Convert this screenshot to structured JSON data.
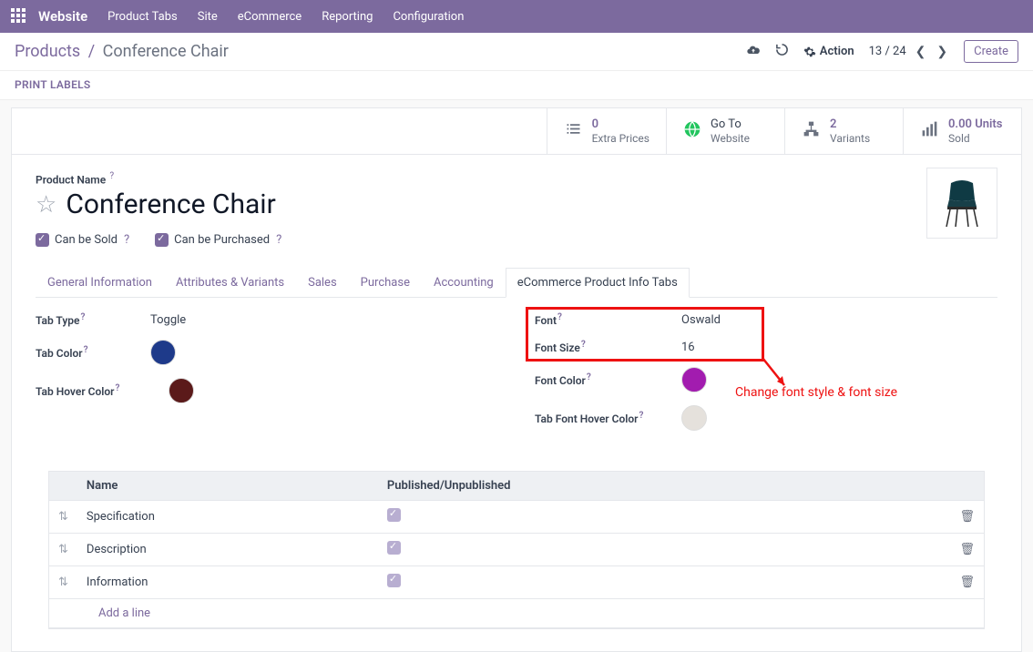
{
  "topnav": {
    "brand": "Website",
    "items": [
      "Product Tabs",
      "Site",
      "eCommerce",
      "Reporting",
      "Configuration"
    ]
  },
  "controlbar": {
    "breadcrumb_root": "Products",
    "breadcrumb_leaf": "Conference Chair",
    "action_label": "Action",
    "pager": "13 / 24",
    "create_label": "Create"
  },
  "secondbar": {
    "print_labels": "PRINT LABELS"
  },
  "stats": [
    {
      "num": "0",
      "label": "Extra Prices",
      "icon": "list"
    },
    {
      "top": "Go To",
      "label": "Website",
      "icon": "globe"
    },
    {
      "num": "2",
      "label": "Variants",
      "icon": "sitemap"
    },
    {
      "num": "0.00 Units",
      "label": "Sold",
      "icon": "bars"
    }
  ],
  "title": {
    "label": "Product Name",
    "value": "Conference Chair",
    "can_sold": "Can be Sold",
    "can_purchased": "Can be Purchased"
  },
  "tabs": [
    "General Information",
    "Attributes & Variants",
    "Sales",
    "Purchase",
    "Accounting",
    "eCommerce Product Info Tabs"
  ],
  "active_tab_index": 5,
  "form": {
    "left": {
      "tab_type_label": "Tab Type",
      "tab_type_value": "Toggle",
      "tab_color_label": "Tab Color",
      "tab_color_value": "#1e3a8a",
      "tab_hover_label": "Tab Hover Color",
      "tab_hover_value": "#5b1a1a"
    },
    "right": {
      "font_label": "Font",
      "font_value": "Oswald",
      "font_size_label": "Font Size",
      "font_size_value": "16",
      "font_color_label": "Font Color",
      "font_color_value": "#a21caf",
      "font_hover_label": "Tab Font Hover Color",
      "font_hover_value": "#e5e1dc"
    }
  },
  "annotation": "Change font style & font size",
  "table": {
    "headers": {
      "name": "Name",
      "published": "Published/Unpublished"
    },
    "rows": [
      {
        "name": "Specification"
      },
      {
        "name": "Description"
      },
      {
        "name": "Information"
      }
    ],
    "add_line": "Add a line"
  }
}
